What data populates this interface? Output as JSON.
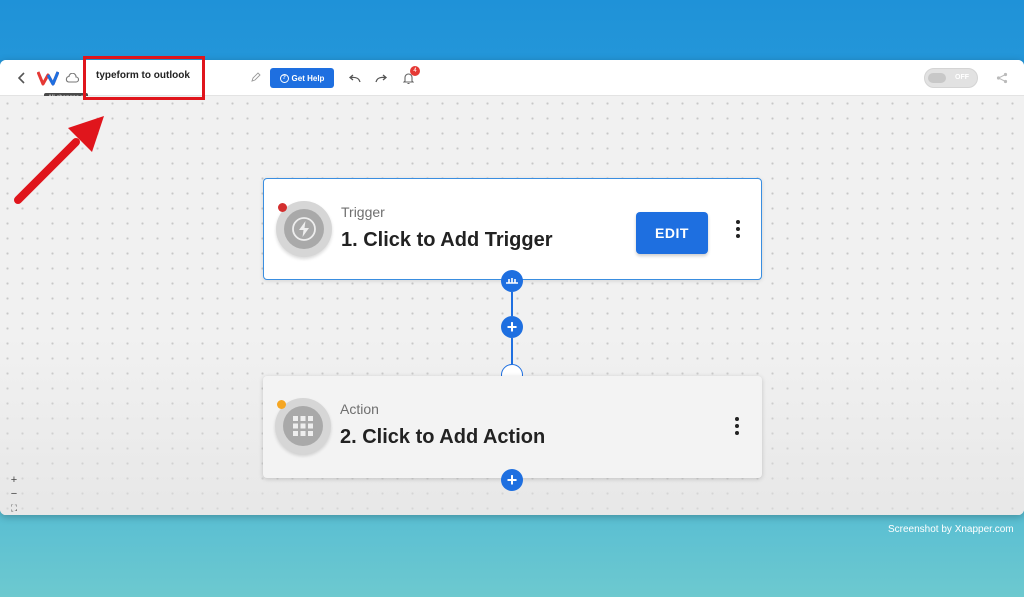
{
  "app": {
    "flow_title": "typeform to outlook",
    "save_status_tooltip": "All changes s",
    "icons": {
      "back": "chevron-left-icon",
      "logo": "w-logo-icon",
      "cloud": "cloud-save-icon",
      "pencil": "pencil-icon",
      "undo": "undo-icon",
      "redo": "redo-icon",
      "bell": "bell-icon",
      "share": "share-icon"
    }
  },
  "toolbar": {
    "help_label": "Get Help",
    "notification_count": "4",
    "toggle_label": "OFF"
  },
  "flow": {
    "trigger": {
      "type_label": "Trigger",
      "title": "1. Click to Add Trigger",
      "edit_label": "EDIT",
      "status_color": "#d32f2f"
    },
    "action": {
      "type_label": "Action",
      "title": "2. Click to Add Action",
      "status_color": "#f5a623"
    }
  },
  "zoom": {
    "in_label": "+",
    "out_label": "−",
    "fit_label": "⛶"
  },
  "annotation": {
    "box_color": "#e0151c",
    "arrow_color": "#e0151c"
  },
  "watermark": "Screenshot by Xnapper.com",
  "colors": {
    "accent": "#1e6fe0",
    "background_top": "#1f92d8",
    "background_bottom": "#6dc9cf"
  }
}
